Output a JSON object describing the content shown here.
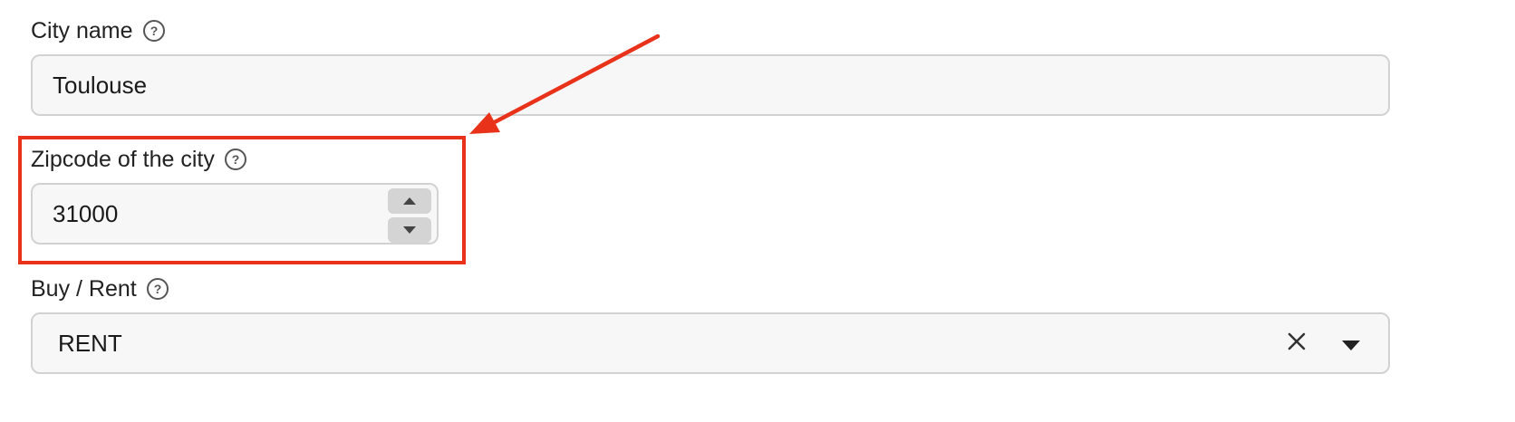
{
  "colors": {
    "annotation": "#e8321a",
    "field_background": "#f7f7f7",
    "field_border": "#d2d2d2"
  },
  "fields": {
    "city_name": {
      "label": "City name",
      "value": "Toulouse",
      "help_icon": "question-circle-icon"
    },
    "zipcode": {
      "label": "Zipcode of the city",
      "value": "31000",
      "help_icon": "question-circle-icon",
      "stepper_icons": [
        "caret-up-icon",
        "caret-down-icon"
      ]
    },
    "buy_rent": {
      "label": "Buy / Rent",
      "value": "RENT",
      "help_icon": "question-circle-icon",
      "clear_icon": "close-icon",
      "dropdown_icon": "caret-down-icon"
    }
  }
}
